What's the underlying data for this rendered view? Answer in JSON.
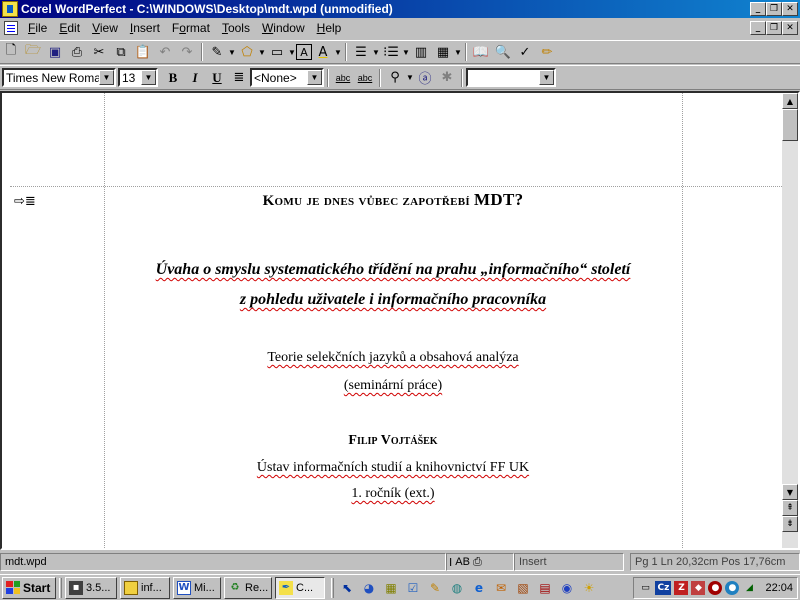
{
  "window": {
    "title": "Corel WordPerfect - C:\\WINDOWS\\Desktop\\mdt.wpd (unmodified)",
    "caption_buttons": [
      "minimize",
      "restore",
      "close"
    ]
  },
  "menu": {
    "items": [
      {
        "label": "File",
        "ul": "F",
        "rest": "ile"
      },
      {
        "label": "Edit",
        "ul": "E",
        "rest": "dit"
      },
      {
        "label": "View",
        "ul": "V",
        "rest": "iew"
      },
      {
        "label": "Insert",
        "ul": "I",
        "rest": "nsert"
      },
      {
        "label": "Format",
        "pre": "F",
        "ul": "o",
        "rest": "rmat"
      },
      {
        "label": "Tools",
        "ul": "T",
        "rest": "ools"
      },
      {
        "label": "Window",
        "ul": "W",
        "rest": "indow"
      },
      {
        "label": "Help",
        "ul": "H",
        "rest": "elp"
      }
    ]
  },
  "toolbar": {
    "icons": [
      "new-document-icon",
      "open-folder-icon",
      "save-icon",
      "print-icon",
      "cut-icon",
      "copy-icon",
      "paste-icon",
      "undo-icon",
      "redo-icon",
      "highlight-icon",
      "shapes-icon",
      "border-icon",
      "text-box-icon",
      "font-color-icon",
      "numbering-icon",
      "bullets-icon",
      "columns-icon",
      "table-icon",
      "book-icon",
      "zoom-icon",
      "spell-check-icon",
      "pen-icon"
    ]
  },
  "property_bar": {
    "font_name": "Times New Roman",
    "font_size": "13",
    "bold": "B",
    "italic": "I",
    "underline": "U",
    "justify_label": "≣",
    "style": "<None>",
    "empty_combo": ""
  },
  "document": {
    "heading_part1": "Komu je dnes vůbec zapotřebí ",
    "heading_part2": "MDT?",
    "subtitle_line1": "Úvaha o smyslu systematického třídění na prahu „informačního“ století",
    "subtitle_line2": "z pohledu uživatele i informačního pracovníka",
    "course": "Teorie selekčních jazyků a obsahová analýza",
    "paper_type": "(seminární práce)",
    "author": "Filip Vojtášek",
    "institute": "Ústav informačních studií a knihovnictví FF UK",
    "year": "1. ročník (ext.)",
    "margin_marker": "⇨≣"
  },
  "statusbar": {
    "filename": "mdt.wpd",
    "mode": "Insert",
    "position": "Pg 1 Ln 20,32cm Pos 17,76cm",
    "ab_label": "AB"
  },
  "taskbar": {
    "start": "Start",
    "buttons": [
      {
        "label": "3.5...",
        "icon": "floppy-icon"
      },
      {
        "label": "inf...",
        "icon": "folder-icon"
      },
      {
        "label": "Mi...",
        "icon": "word-icon"
      },
      {
        "label": "Re...",
        "icon": "recycle-icon"
      },
      {
        "label": "C...",
        "icon": "corel-icon"
      }
    ],
    "language": "Cz",
    "clock": "22:04"
  }
}
